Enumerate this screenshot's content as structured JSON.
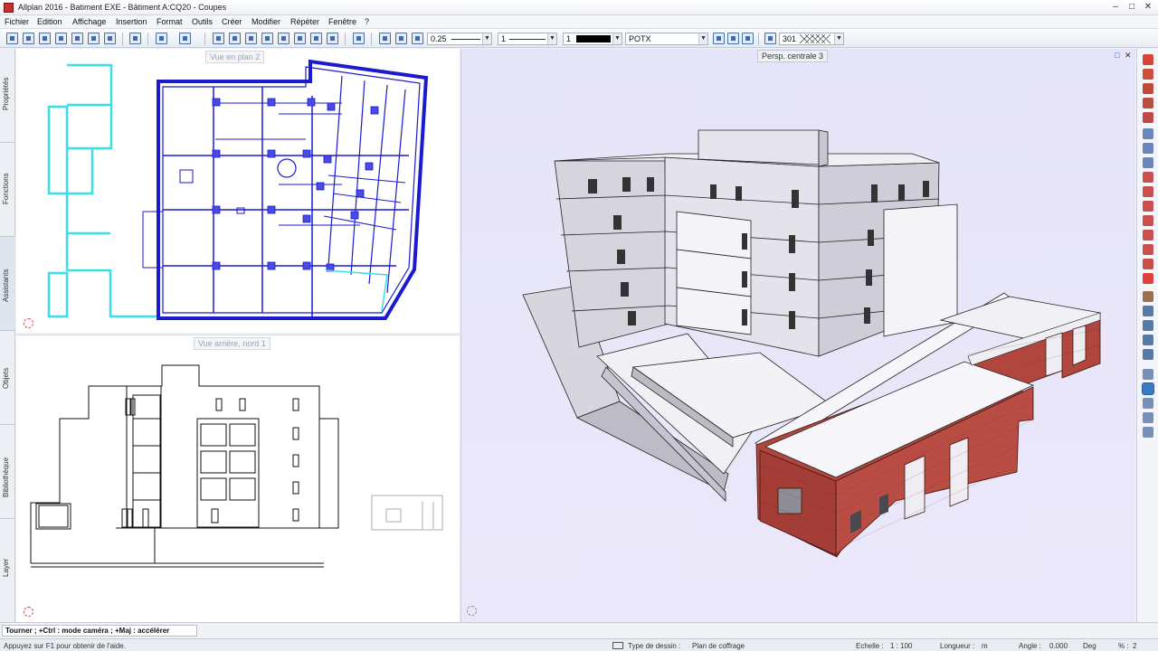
{
  "window": {
    "title": "Allplan 2016 - Batiment EXE - Bâtiment A:CQ20 - Coupes",
    "controls": [
      "–",
      "□",
      "✕"
    ]
  },
  "menu": [
    "Fichier",
    "Edition",
    "Affichage",
    "Insertion",
    "Format",
    "Outils",
    "Créer",
    "Modifier",
    "Répéter",
    "Fenêtre",
    "?"
  ],
  "toolbar": {
    "pen_thickness": "0.25",
    "line_type": "1",
    "color": "1",
    "layer": "POTX",
    "hatch": "301"
  },
  "left_panel_tabs": [
    "Propriétés",
    "Fonctions",
    "Assistants",
    "Objets",
    "Bibliothèque",
    "Layer"
  ],
  "viewports": {
    "plan": {
      "label": "Vue en plan 2"
    },
    "elevation": {
      "label": "Vue arrière, nord 1"
    },
    "perspective": {
      "label": "Persp. centrale 3",
      "controls": [
        "□",
        "✕"
      ]
    }
  },
  "prompt": "Tourner ; +Ctrl : mode caméra ; +Maj : accélérer",
  "status": {
    "help": "Appuyez sur F1 pour obtenir de l'aide.",
    "drawing_type_label": "Type de dessin :",
    "drawing_type": "Plan de coffrage",
    "scale_label": "Echelle :",
    "scale": "1 : 100",
    "length_label": "Longueur :",
    "length_unit": "m",
    "angle_label": "Angle :",
    "angle": "0.000",
    "angle_unit": "Deg",
    "percent_label": "% :",
    "percent": "2"
  },
  "colors": {
    "plan_walls": "#1a1ad0",
    "plan_cyan": "#38e0e6",
    "perspective_bg": "#e8e6f8",
    "brick": "#b0463e"
  }
}
